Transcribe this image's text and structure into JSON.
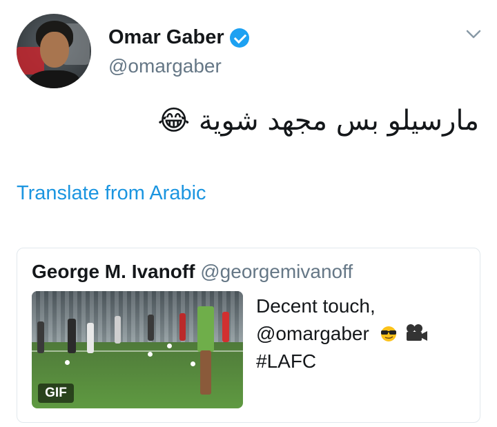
{
  "author": {
    "name": "Omar Gaber",
    "handle": "@omargaber",
    "verified": true,
    "verified_color": "#1da1f2",
    "avatar_icon": "profile-photo"
  },
  "menu_icon": "chevron-down-icon",
  "tweet": {
    "text": "مارسيلو بس مجهد شوية",
    "emoji": "😂",
    "emoji_name": "tears-of-joy-emoji"
  },
  "translate": {
    "label": "Translate from Arabic",
    "color": "#1b95e0"
  },
  "quoted_tweet": {
    "author_name": "George M. Ivanoff",
    "author_handle": "@georgemivanoff",
    "text_lines": [
      "Decent touch,",
      "@omargaber",
      "#LAFC"
    ],
    "emojis": [
      "sunglasses-emoji",
      "movie-camera-emoji"
    ],
    "media": {
      "type": "gif",
      "badge": "GIF"
    }
  }
}
